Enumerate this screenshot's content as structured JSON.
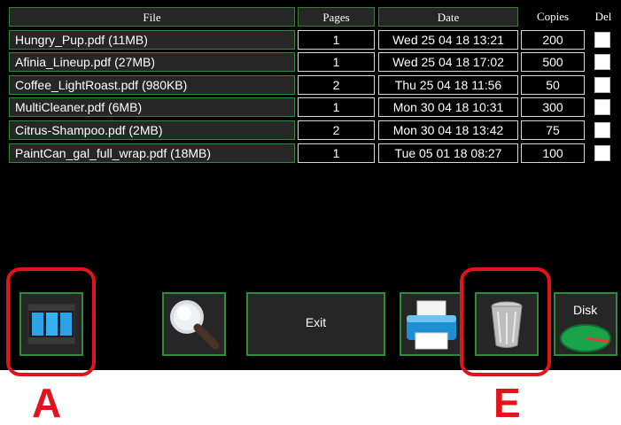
{
  "table": {
    "headers": {
      "file": "File",
      "pages": "Pages",
      "date": "Date",
      "copies": "Copies",
      "del": "Del"
    },
    "rows": [
      {
        "file": "Hungry_Pup.pdf (11MB)",
        "pages": "1",
        "date": "Wed 25 04 18 13:21",
        "copies": "200",
        "del": false
      },
      {
        "file": "Afinia_Lineup.pdf (27MB)",
        "pages": "1",
        "date": "Wed 25 04 18 17:02",
        "copies": "500",
        "del": false
      },
      {
        "file": "Coffee_LightRoast.pdf (980KB)",
        "pages": "2",
        "date": "Thu 25 04 18 11:56",
        "copies": "50",
        "del": false
      },
      {
        "file": "MultiCleaner.pdf (6MB)",
        "pages": "1",
        "date": "Mon 30 04 18 10:31",
        "copies": "300",
        "del": false
      },
      {
        "file": "Citrus-Shampoo.pdf (2MB)",
        "pages": "2",
        "date": "Mon 30 04 18 13:42",
        "copies": "75",
        "del": false
      },
      {
        "file": "PaintCan_gal_full_wrap.pdf (18MB)",
        "pages": "1",
        "date": "Tue 05 01 18 08:27",
        "copies": "100",
        "del": false
      }
    ]
  },
  "toolbar": {
    "exit_label": "Exit",
    "disk_label": "Disk",
    "icons": [
      "film-strip-icon",
      "magnifier-icon",
      "printer-icon",
      "trash-can-icon",
      "disk-gauge-icon"
    ]
  },
  "callouts": {
    "a": "A",
    "e": "E"
  },
  "colors": {
    "accent_green": "#2e8b3a",
    "callout_red": "#e2141b",
    "screen_bg": "#000000"
  }
}
